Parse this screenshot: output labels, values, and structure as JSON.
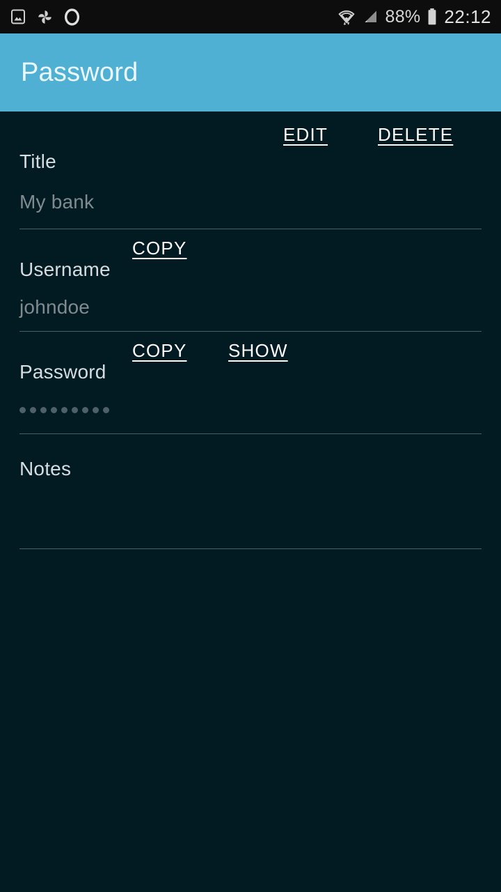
{
  "status_bar": {
    "icons_left": [
      "gallery-icon",
      "pinwheel-icon",
      "vodafone-icon"
    ],
    "wifi_icon": "wifi-icon",
    "signal_icon": "signal-icon",
    "battery_percent": "88%",
    "battery_icon": "battery-icon",
    "clock": "22:12"
  },
  "app_bar": {
    "title": "Password"
  },
  "fields": {
    "title": {
      "label": "Title",
      "value": "My bank",
      "edit_label": "EDIT",
      "delete_label": "DELETE"
    },
    "username": {
      "label": "Username",
      "value": "johndoe",
      "copy_label": "COPY"
    },
    "password": {
      "label": "Password",
      "masked_char_count": 9,
      "copy_label": "COPY",
      "show_label": "SHOW"
    },
    "notes": {
      "label": "Notes",
      "value": ""
    }
  },
  "colors": {
    "app_bar": "#4fb0d4",
    "background": "#021a22",
    "status_bar": "#0d0d0d",
    "label_text": "#d5dde0",
    "value_text": "#7f8b8f",
    "action_text": "#ffffff",
    "divider": "#4b5e65"
  }
}
